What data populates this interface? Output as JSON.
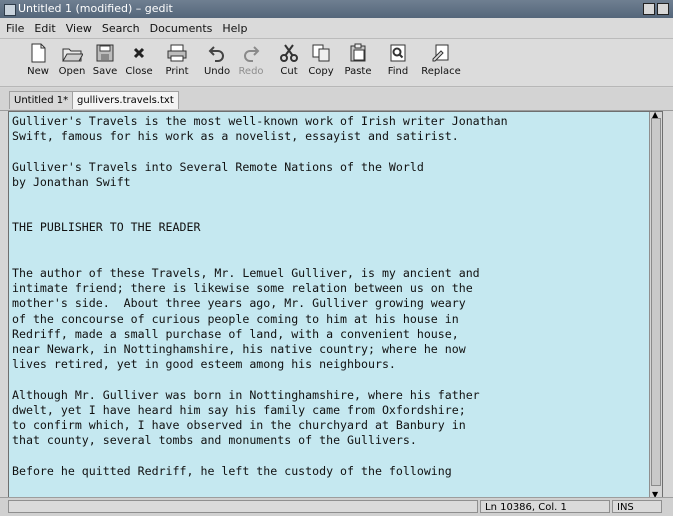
{
  "window": {
    "title": "Untitled 1 (modified) – gedit"
  },
  "menubar": {
    "items": [
      "File",
      "Edit",
      "View",
      "Search",
      "Documents",
      "Help"
    ]
  },
  "toolbar": {
    "buttons": [
      {
        "label": "New",
        "icon": "new-document-icon"
      },
      {
        "label": "Open",
        "icon": "open-folder-icon"
      },
      {
        "label": "Save",
        "icon": "save-icon"
      },
      {
        "label": "Close",
        "icon": "close-icon"
      },
      {
        "label": "Print",
        "icon": "print-icon"
      },
      {
        "label": "Undo",
        "icon": "undo-icon"
      },
      {
        "label": "Redo",
        "icon": "redo-icon"
      },
      {
        "label": "Cut",
        "icon": "cut-icon"
      },
      {
        "label": "Copy",
        "icon": "copy-icon"
      },
      {
        "label": "Paste",
        "icon": "paste-icon"
      },
      {
        "label": "Find",
        "icon": "find-icon"
      },
      {
        "label": "Replace",
        "icon": "replace-icon"
      }
    ]
  },
  "tabs": [
    {
      "label": "Untitled 1*"
    },
    {
      "label": "gullivers.travels.txt"
    }
  ],
  "editor": {
    "content": "Gulliver's Travels is the most well-known work of Irish writer Jonathan\nSwift, famous for his work as a novelist, essayist and satirist.\n\nGulliver's Travels into Several Remote Nations of the World\nby Jonathan Swift\n\n\nTHE PUBLISHER TO THE READER\n\n\nThe author of these Travels, Mr. Lemuel Gulliver, is my ancient and\nintimate friend; there is likewise some relation between us on the\nmother's side.  About three years ago, Mr. Gulliver growing weary\nof the concourse of curious people coming to him at his house in\nRedriff, made a small purchase of land, with a convenient house,\nnear Newark, in Nottinghamshire, his native country; where he now\nlives retired, yet in good esteem among his neighbours.\n\nAlthough Mr. Gulliver was born in Nottinghamshire, where his father\ndwelt, yet I have heard him say his family came from Oxfordshire;\nto confirm which, I have observed in the churchyard at Banbury in\nthat county, several tombs and monuments of the Gullivers.\n\nBefore he quitted Redriff, he left the custody of the following"
  },
  "statusbar": {
    "position": "Ln 10386, Col. 1",
    "mode": "INS"
  },
  "colors": {
    "editor_background": "#c5e8f0",
    "titlebar": "#5f7185"
  }
}
